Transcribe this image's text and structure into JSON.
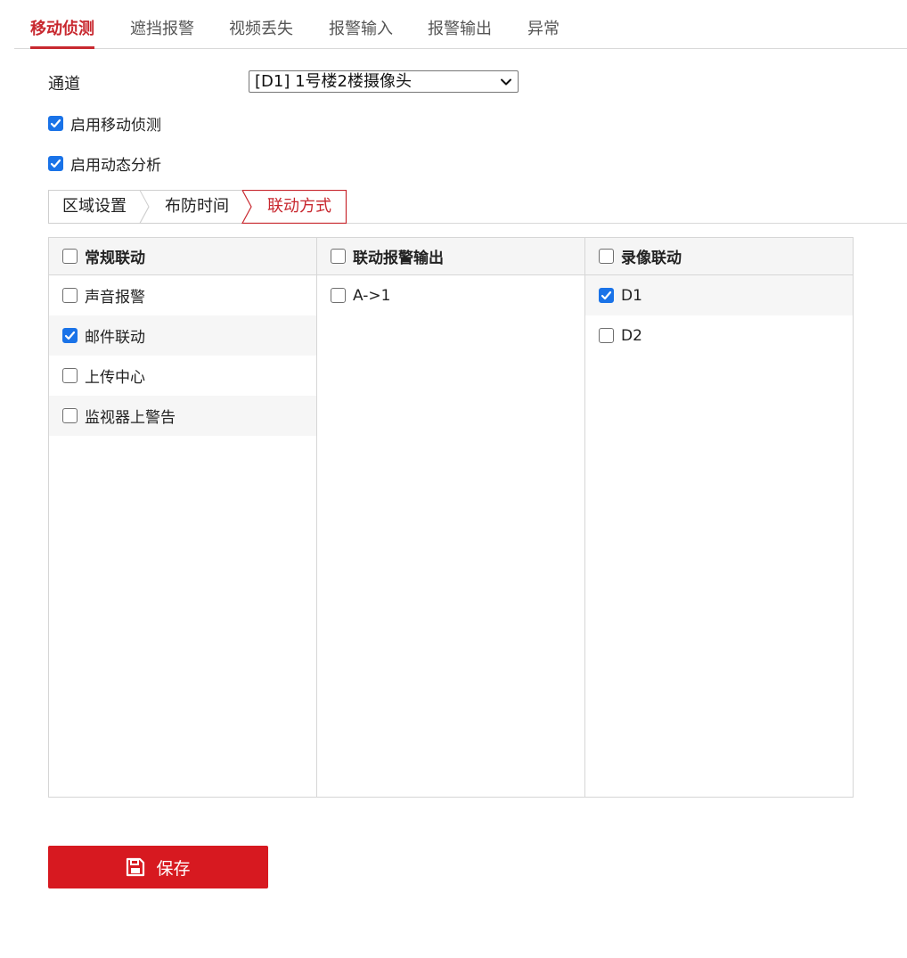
{
  "top_tabs": [
    {
      "label": "移动侦测",
      "active": true
    },
    {
      "label": "遮挡报警",
      "active": false
    },
    {
      "label": "视频丢失",
      "active": false
    },
    {
      "label": "报警输入",
      "active": false
    },
    {
      "label": "报警输出",
      "active": false
    },
    {
      "label": "异常",
      "active": false
    }
  ],
  "channel": {
    "label": "通道",
    "selected": "[D1] 1号楼2楼摄像头"
  },
  "options": {
    "enable_motion_detection": {
      "label": "启用移动侦测",
      "checked": true
    },
    "enable_dynamic_analysis": {
      "label": "启用动态分析",
      "checked": true
    }
  },
  "sub_tabs": [
    {
      "label": "区域设置",
      "active": false
    },
    {
      "label": "布防时间",
      "active": false
    },
    {
      "label": "联动方式",
      "active": true
    }
  ],
  "linkage": {
    "columns": [
      {
        "header": "常规联动",
        "checked": false,
        "items": [
          {
            "label": "声音报警",
            "checked": false
          },
          {
            "label": "邮件联动",
            "checked": true
          },
          {
            "label": "上传中心",
            "checked": false
          },
          {
            "label": "监视器上警告",
            "checked": false
          }
        ]
      },
      {
        "header": "联动报警输出",
        "checked": false,
        "items": [
          {
            "label": "A->1",
            "checked": false
          }
        ]
      },
      {
        "header": "录像联动",
        "checked": false,
        "items": [
          {
            "label": "D1",
            "checked": true
          },
          {
            "label": "D2",
            "checked": false
          }
        ]
      }
    ]
  },
  "save_button": {
    "label": "保存",
    "icon": "save-icon"
  },
  "colors": {
    "accent": "#c8282f",
    "save_button_bg": "#d71920",
    "checkbox_checked": "#1a73e8"
  }
}
